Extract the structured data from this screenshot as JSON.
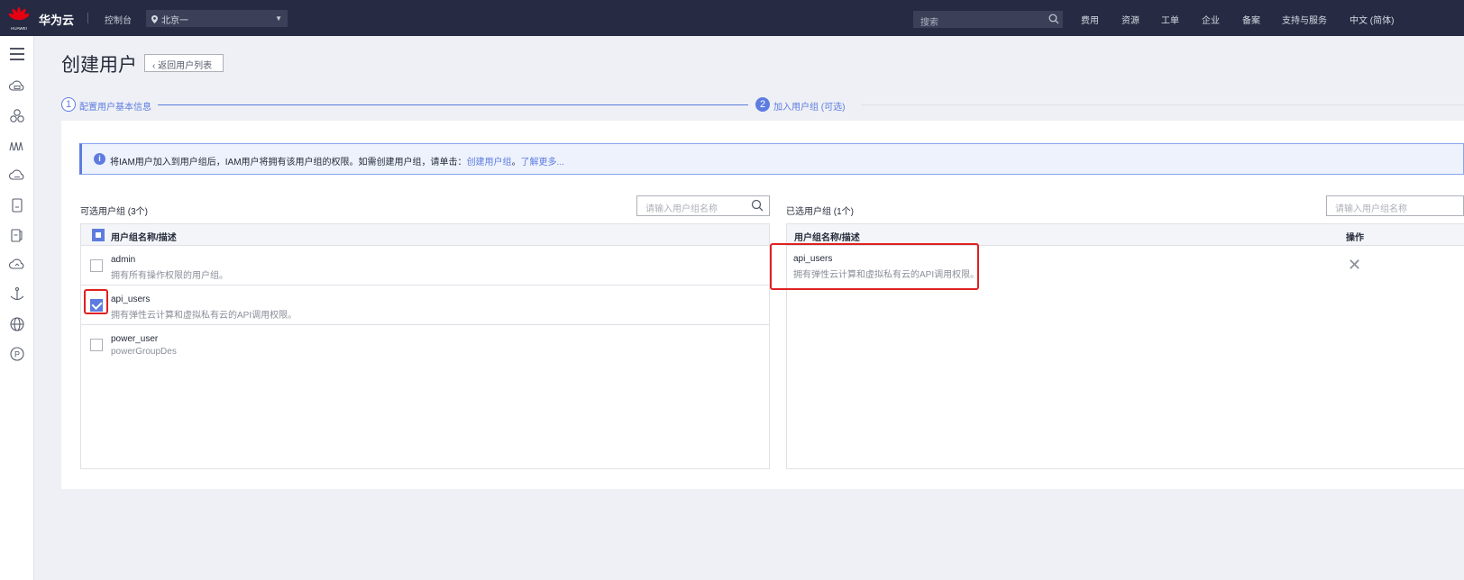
{
  "topbar": {
    "brand": "华为云",
    "logo_text": "HUAWEI",
    "console": "控制台",
    "region": "北京一",
    "search_placeholder": "搜索",
    "nav": [
      "费用",
      "资源",
      "工单",
      "企业",
      "备案",
      "支持与服务",
      "中文 (简体)"
    ]
  },
  "sidebar": {
    "icons": [
      "menu-icon",
      "cloud-server-icon",
      "cluster-icon",
      "waves-icon",
      "cloud-storage-icon",
      "file-icon",
      "mobile-icon",
      "cloud-icon",
      "anchor-icon",
      "globe-icon",
      "p-circle-icon"
    ]
  },
  "page": {
    "title": "创建用户",
    "back_label": "返回用户列表"
  },
  "steps": [
    {
      "num": "1",
      "label": "配置用户基本信息"
    },
    {
      "num": "2",
      "label": "加入用户组 (可选)"
    }
  ],
  "info": {
    "icon": "i",
    "text": "将IAM用户加入到用户组后，IAM用户将拥有该用户组的权限。如需创建用户组，请单击：",
    "link_create": "创建用户组",
    "mid": "。",
    "link_more": "了解更多..."
  },
  "available": {
    "title": "可选用户组 (3个)",
    "filter_placeholder": "请输入用户组名称",
    "header": "用户组名称/描述",
    "rows": [
      {
        "name": "admin",
        "desc": "拥有所有操作权限的用户组。",
        "checked": false
      },
      {
        "name": "api_users",
        "desc": "拥有弹性云计算和虚拟私有云的API调用权限。",
        "checked": true
      },
      {
        "name": "power_user",
        "desc": "powerGroupDes",
        "checked": false
      }
    ]
  },
  "selected": {
    "title": "已选用户组 (1个)",
    "filter_placeholder": "请输入用户组名称",
    "header": "用户组名称/描述",
    "header_action": "操作",
    "rows": [
      {
        "name": "api_users",
        "desc": "拥有弹性云计算和虚拟私有云的API调用权限。"
      }
    ]
  },
  "colors": {
    "topbar": "#262a42",
    "accent": "#5e7ce0",
    "highlight": "#e02020"
  }
}
